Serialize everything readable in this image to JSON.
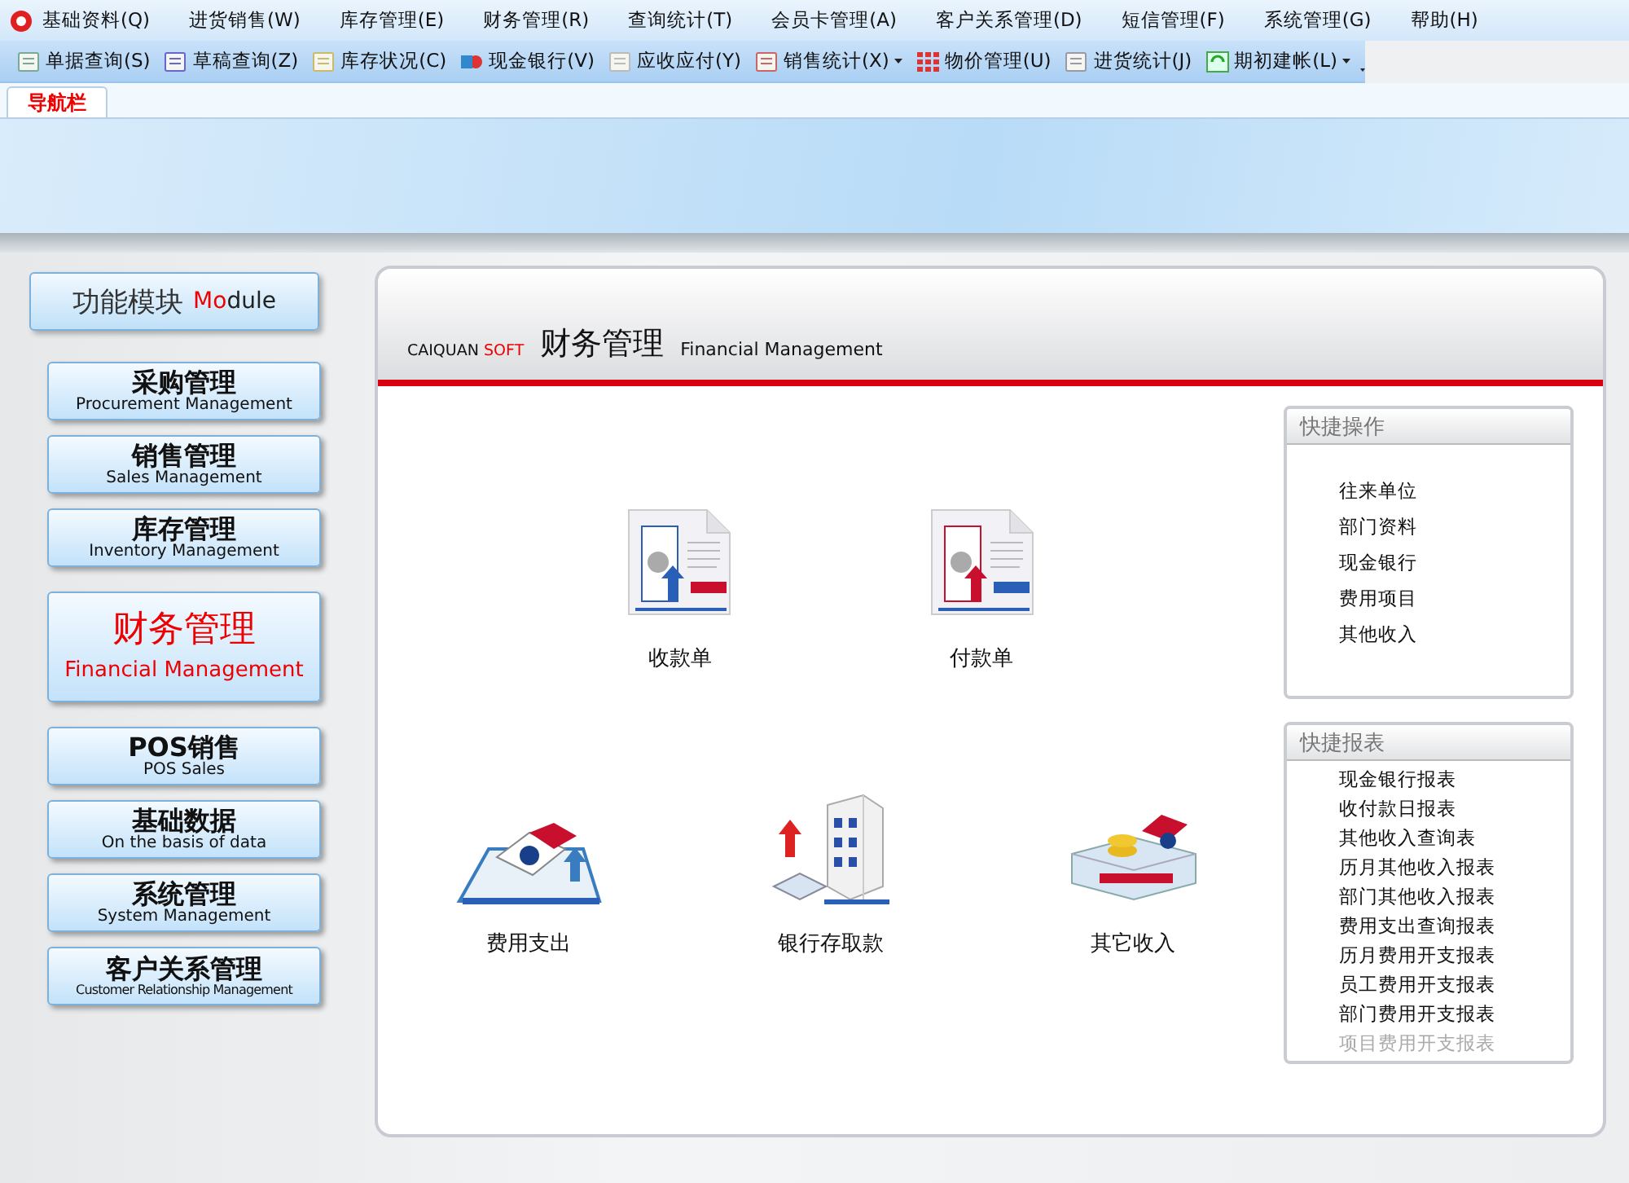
{
  "menu_bar": {
    "items": [
      {
        "label": "基础资料(Q)"
      },
      {
        "label": "进货销售(W)"
      },
      {
        "label": "库存管理(E)"
      },
      {
        "label": "财务管理(R)"
      },
      {
        "label": "查询统计(T)"
      },
      {
        "label": "会员卡管理(A)"
      },
      {
        "label": "客户关系管理(D)"
      },
      {
        "label": "短信管理(F)"
      },
      {
        "label": "系统管理(G)"
      },
      {
        "label": "帮助(H)"
      }
    ]
  },
  "toolbar": {
    "items": [
      {
        "label": "单据查询(S)",
        "kind": "form",
        "has_menu": false
      },
      {
        "label": "草稿查询(Z)",
        "kind": "clipboard",
        "has_menu": false
      },
      {
        "label": "库存状况(C)",
        "kind": "stack",
        "has_menu": false
      },
      {
        "label": "现金银行(V)",
        "kind": "shapes",
        "has_menu": false
      },
      {
        "label": "应收应付(Y)",
        "kind": "tray",
        "has_menu": false
      },
      {
        "label": "销售统计(X)",
        "kind": "report",
        "has_menu": true
      },
      {
        "label": "物价管理(U)",
        "kind": "grid",
        "has_menu": false
      },
      {
        "label": "进货统计(J)",
        "kind": "folder",
        "has_menu": false
      },
      {
        "label": "期初建帐(L)",
        "kind": "refresh",
        "has_menu": true
      }
    ]
  },
  "tabs": [
    {
      "label": "导航栏",
      "selected": true
    }
  ],
  "sidebar": {
    "header": {
      "title": "功能模块",
      "accent": "Mo",
      "rest": "dule"
    },
    "modules": [
      {
        "title": "采购管理",
        "subtitle": "Procurement Management",
        "selected": false
      },
      {
        "title": "销售管理",
        "subtitle": "Sales Management",
        "selected": false
      },
      {
        "title": "库存管理",
        "subtitle": "Inventory Management",
        "selected": false
      },
      {
        "title": "财务管理",
        "subtitle": "Financial Management",
        "selected": true
      },
      {
        "title": "POS销售",
        "subtitle": "POS Sales",
        "selected": false
      },
      {
        "title": "基础数据",
        "subtitle": "On the basis of data",
        "selected": false
      },
      {
        "title": "系统管理",
        "subtitle": "System Management",
        "selected": false
      },
      {
        "title": "客户关系管理",
        "subtitle": "Customer Relationship Management",
        "selected": false
      }
    ]
  },
  "panel": {
    "brand": {
      "name": "CAIQUAN",
      "accent": "SOFT"
    },
    "title": "财务管理",
    "subtitle": "Financial Management",
    "functions": [
      {
        "label": "收款单",
        "kind": "receipt"
      },
      {
        "label": "付款单",
        "kind": "payment"
      },
      {
        "label": "费用支出",
        "kind": "expense"
      },
      {
        "label": "银行存取款",
        "kind": "bank"
      },
      {
        "label": "其它收入",
        "kind": "income"
      }
    ],
    "quick_actions": {
      "title": "快捷操作",
      "items": [
        {
          "label": "往来单位"
        },
        {
          "label": "部门资料"
        },
        {
          "label": "现金银行"
        },
        {
          "label": "费用项目"
        },
        {
          "label": "其他收入"
        }
      ]
    },
    "quick_reports": {
      "title": "快捷报表",
      "items": [
        {
          "label": "现金银行报表",
          "disabled": false
        },
        {
          "label": "收付款日报表",
          "disabled": false
        },
        {
          "label": "其他收入查询表",
          "disabled": false
        },
        {
          "label": "历月其他收入报表",
          "disabled": false
        },
        {
          "label": "部门其他收入报表",
          "disabled": false
        },
        {
          "label": "费用支出查询报表",
          "disabled": false
        },
        {
          "label": "历月费用开支报表",
          "disabled": false
        },
        {
          "label": "员工费用开支报表",
          "disabled": false
        },
        {
          "label": "部门费用开支报表",
          "disabled": false
        },
        {
          "label": "项目费用开支报表",
          "disabled": true
        }
      ]
    }
  }
}
